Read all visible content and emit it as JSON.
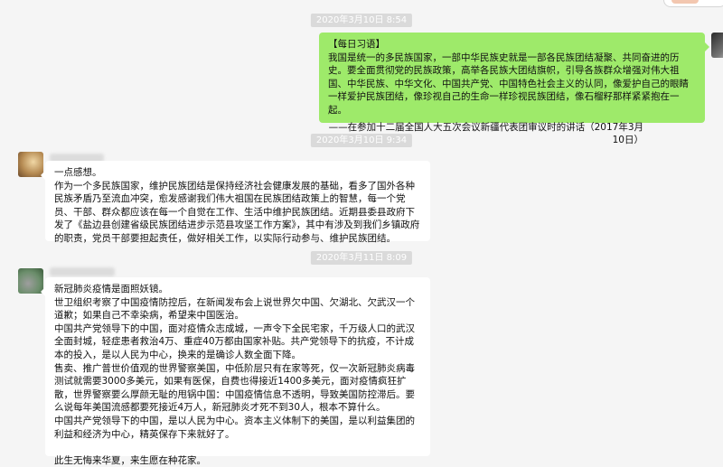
{
  "colors": {
    "background": "#f5f5f5",
    "sent_bubble": "#9eea6a",
    "received_bubble": "#ffffff",
    "timestamp_bg": "#dadada"
  },
  "top_button": {
    "icon": "close-icon",
    "glyph": "×"
  },
  "messages": [
    {
      "timestamp": "2020年3月10日 8:54",
      "direction": "sent",
      "paragraphs": [
        "【每日习语】",
        "我国是统一的多民族国家，一部中华民族史就是一部各民族团结凝聚、共同奋进的历史。要全面贯彻党的民族政策，高举各民族大团结旗帜，引导各族群众增强对伟大祖国、中华民族、中华文化、中国共产党、中国特色社会主义的认同，像爱护自己的眼睛一样爱护民族团结，像珍视自己的生命一样珍视民族团结，像石榴籽那样紧紧抱在一起。",
        "——在参加十二届全国人大五次会议新疆代表团审议时的讲话（2017年3月10日）"
      ]
    },
    {
      "timestamp": "2020年3月10日 9:34",
      "direction": "received",
      "paragraphs": [
        "一点感想。",
        "作为一个多民族国家，维护民族团结是保持经济社会健康发展的基础，看多了国外各种民族矛盾乃至流血冲突，愈发感谢我们伟大祖国在民族团结政策上的智慧，每一个党员、干部、群众都应该在每一个自觉在工作、生活中维护民族团结。近期县委县政府下发了《盐边县创建省级民族团结进步示范县攻坚工作方案》，其中有涉及到我们乡镇政府的职责，党员干部要担起责任，做好相关工作，以实际行动参与、维护民族团结。"
      ]
    },
    {
      "timestamp": "2020年3月11日 8:09",
      "direction": "received",
      "paragraphs": [
        "新冠肺炎疫情是面照妖镜。",
        "世卫组织考察了中国疫情防控后，在新闻发布会上说世界欠中国、欠湖北、欠武汉一个道歉；如果自己不幸染病，希望来中国医治。",
        "中国共产党领导下的中国，面对疫情众志成城，一声令下全民宅家，千万级人口的武汉全面封城，轻症患者救治4万、重症40万都由国家补贴。共产党领导下的抗疫，不计成本的投入，是以人民为中心，换来的是确诊人数全面下降。",
        "售卖、推广普世价值观的世界警察美国，中低阶层只有在家等死，仅一次新冠肺炎病毒测试就需要3000多美元，如果有医保，自费也得接近1400多美元，面对疫情疯狂扩散，世界警察要么厚颜无耻的甩锅中国：中国疫情信息不透明，导致美国防控滞后。要么说每年美国流感都要死接近4万人，新冠肺炎才死不到30人，根本不算什么。",
        "中国共产党领导下的中国，是以人民为中心。资本主义体制下的美国，是以利益集团的利益和经济为中心，精英保存下来就好了。",
        "",
        "此生无悔来华夏，来生愿在种花家。"
      ]
    }
  ]
}
